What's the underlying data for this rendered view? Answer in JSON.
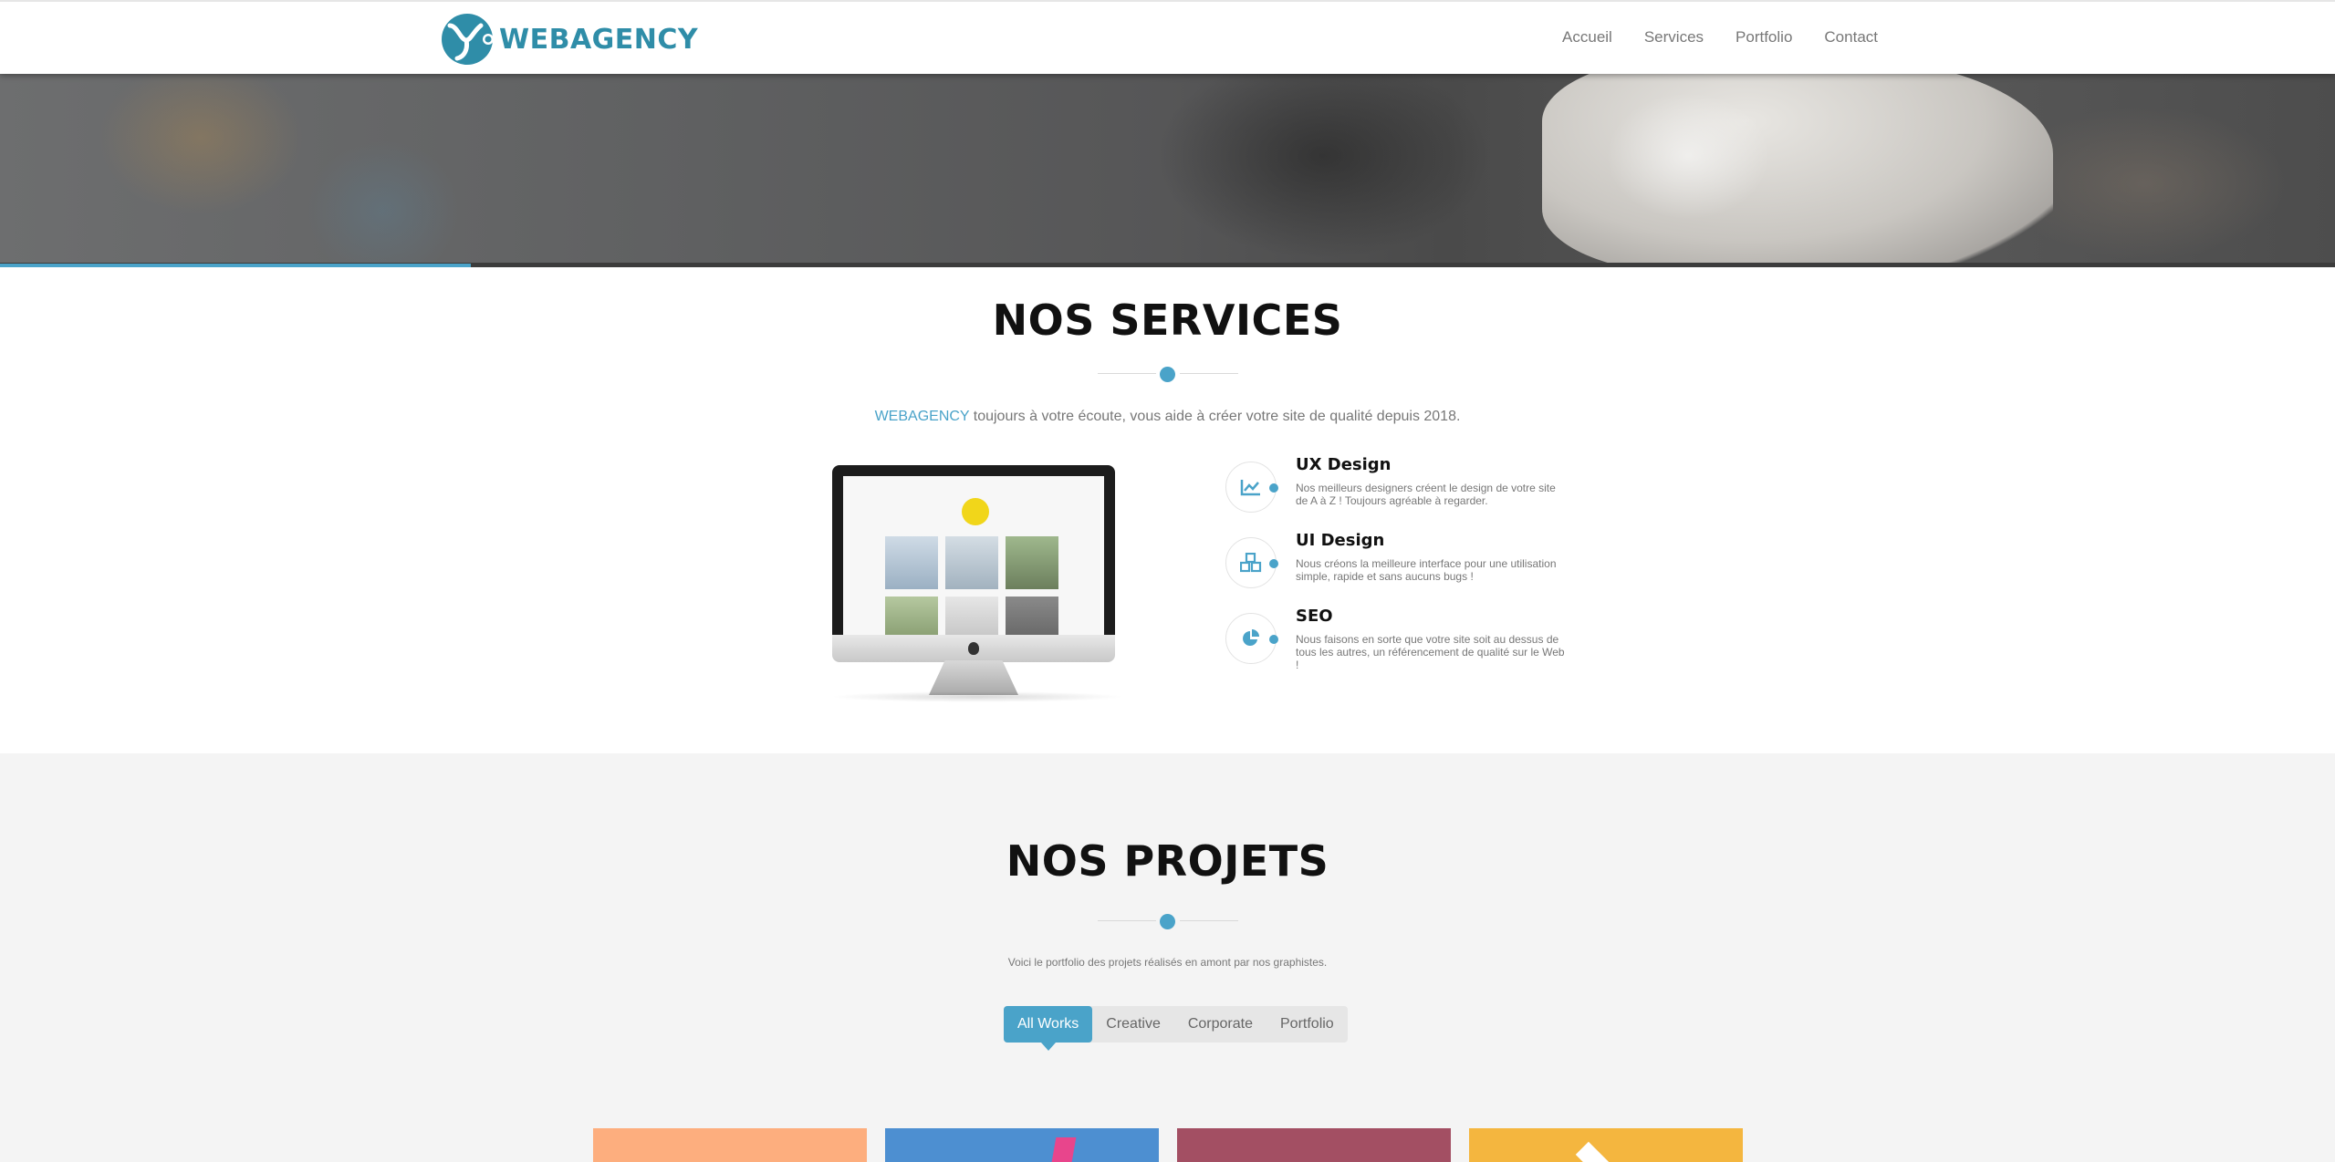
{
  "header": {
    "brand": "WEBAGENCY",
    "nav": [
      "Accueil",
      "Services",
      "Portfolio",
      "Contact"
    ]
  },
  "hero": {
    "progress_percent": 20
  },
  "services": {
    "title": "NOS SERVICES",
    "intro_brand": "WEBAGENCY",
    "intro_text": " toujours à votre écoute, vous aide à créer votre site de qualité depuis 2018.",
    "items": [
      {
        "icon": "line-chart-icon",
        "title": "UX Design",
        "text": "Nos meilleurs designers créent le design de votre site de A à Z ! Toujours agréable à regarder."
      },
      {
        "icon": "cubes-icon",
        "title": "UI Design",
        "text": "Nous créons la meilleure interface pour une utilisation simple, rapide et sans aucuns bugs !"
      },
      {
        "icon": "pie-chart-icon",
        "title": "SEO",
        "text": "Nous faisons en sorte que votre site soit au dessus de tous les autres, un référencement de qualité sur le Web !"
      }
    ]
  },
  "projects": {
    "title": "NOS PROJETS",
    "intro": "Voici le portfolio des projets réalisés en amont par nos graphistes.",
    "filters": [
      "All Works",
      "Creative",
      "Corporate",
      "Portfolio"
    ],
    "active_filter": "All Works",
    "card_colors": [
      "#fdae7e",
      "#4d8fd1",
      "#a34f63",
      "#f4b63f"
    ]
  },
  "colors": {
    "accent": "#4aa3c9",
    "brand": "#2f8da8"
  }
}
